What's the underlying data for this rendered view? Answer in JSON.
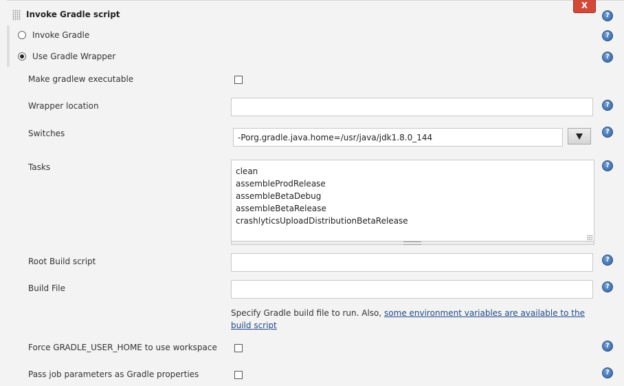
{
  "section": {
    "title": "Invoke Gradle script",
    "delete_label": "X"
  },
  "help_symbol": "?",
  "gradle_mode": {
    "invoke_label": "Invoke Gradle",
    "wrapper_label": "Use Gradle Wrapper",
    "selected": "wrapper"
  },
  "fields": {
    "make_executable_label": "Make gradlew executable",
    "wrapper_location_label": "Wrapper location",
    "wrapper_location_value": "",
    "switches_label": "Switches",
    "switches_value": "-Porg.gradle.java.home=/usr/java/jdk1.8.0_144",
    "tasks_label": "Tasks",
    "tasks_lines": [
      "clean",
      "assembleProdRelease",
      "assembleBetaDebug",
      "assembleBetaRelease",
      "crashlyticsUploadDistributionBetaRelease"
    ],
    "root_build_label": "Root Build script",
    "root_build_value": "",
    "build_file_label": "Build File",
    "build_file_value": "",
    "build_file_help_prefix": "Specify Gradle build file to run. Also, ",
    "build_file_help_link": "some environment variables are available to the build script",
    "force_home_label": "Force GRADLE_USER_HOME to use workspace",
    "pass_params_label": "Pass job parameters as Gradle properties"
  },
  "colors": {
    "delete_button": "#d24939",
    "link": "#204a87",
    "help_icon": "#2f5f9f"
  }
}
